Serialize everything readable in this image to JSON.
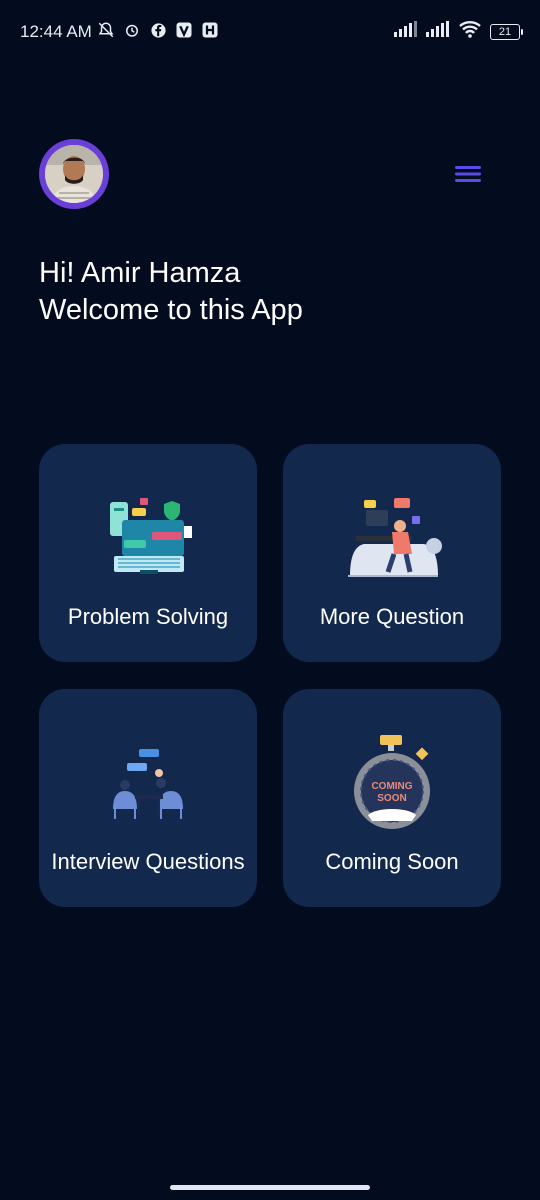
{
  "status_bar": {
    "time": "12:44 AM",
    "battery": "21",
    "left_icons": [
      "bell-off-icon",
      "alarm-icon",
      "facebook-icon",
      "v-app-icon",
      "h-app-icon"
    ],
    "right_icons": [
      "signal-icon",
      "signal-icon",
      "wifi-icon",
      "battery-icon"
    ]
  },
  "header": {
    "avatar": "profile-avatar",
    "menu_icon": "hamburger-menu-icon",
    "accent_color": "#5b4bea"
  },
  "greeting": {
    "line1": "Hi! Amir Hamza",
    "line2": "Welcome to this App"
  },
  "cards": [
    {
      "label": "Problem Solving",
      "icon": "coding-laptop-illustration"
    },
    {
      "label": "More Question",
      "icon": "developer-desk-illustration"
    },
    {
      "label": "Interview Questions",
      "icon": "interview-illustration"
    },
    {
      "label": "Coming Soon",
      "icon": "coming-soon-stopwatch-illustration",
      "badge_text": "COMING SOON"
    }
  ],
  "colors": {
    "background": "#030b1f",
    "card": "#13284d",
    "avatar_ring": "#6a3fd8"
  }
}
